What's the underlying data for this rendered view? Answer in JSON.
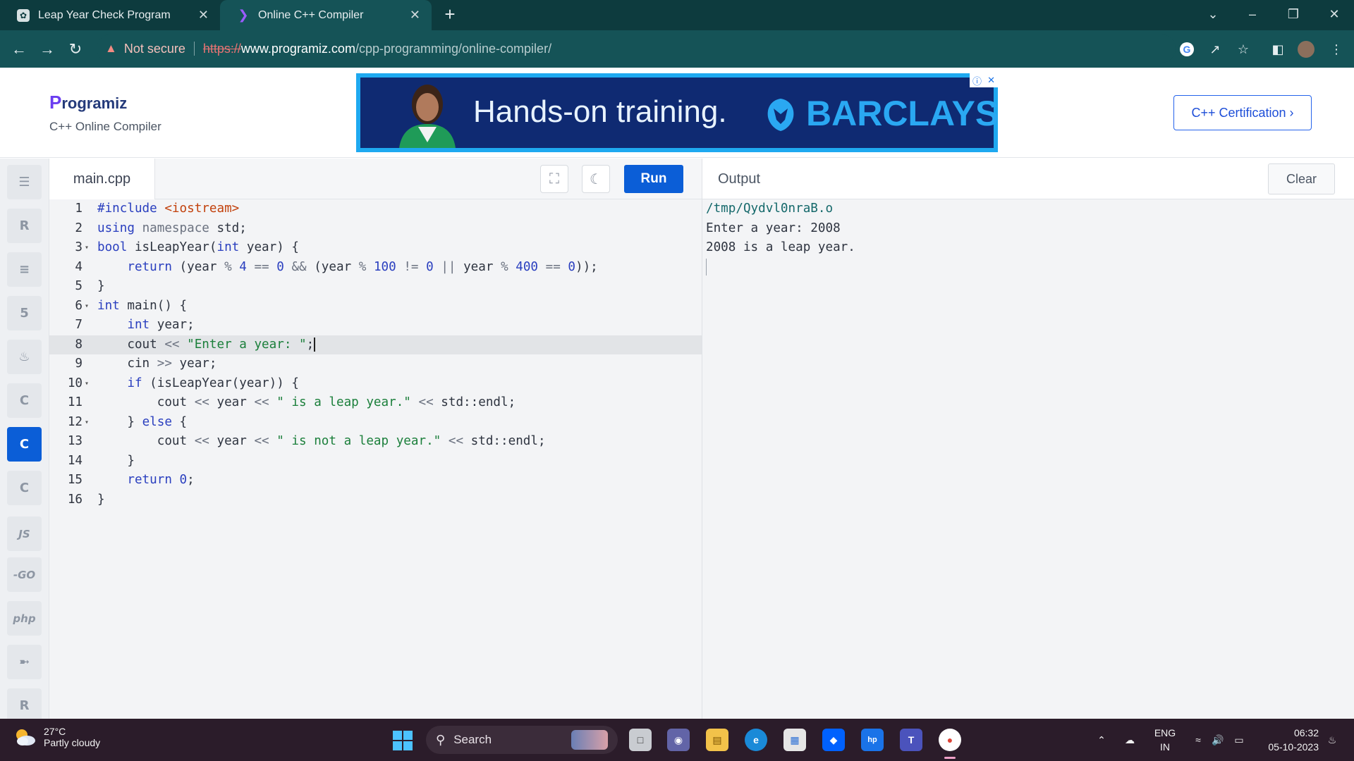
{
  "browser": {
    "tabs": [
      {
        "title": "Leap Year Check Program"
      },
      {
        "title": "Online C++ Compiler"
      }
    ],
    "address": {
      "security_label": "Not secure",
      "scheme": "https://",
      "domain": "www.programiz.com",
      "path": "/cpp-programming/online-compiler/"
    }
  },
  "header": {
    "logo_p": "P",
    "logo_rest": "rogramiz",
    "subtitle": "C++ Online Compiler",
    "ad_text": "Hands-on training.",
    "ad_brand": "BARCLAYS",
    "cert_button": "C++ Certification ›"
  },
  "sidebar": {
    "items": [
      {
        "name": "python",
        "glyph": "☰"
      },
      {
        "name": "r",
        "glyph": "R"
      },
      {
        "name": "sql",
        "glyph": "≡"
      },
      {
        "name": "html",
        "glyph": "5"
      },
      {
        "name": "java",
        "glyph": "♨"
      },
      {
        "name": "c",
        "glyph": "C"
      },
      {
        "name": "cpp",
        "glyph": "C"
      },
      {
        "name": "csharp",
        "glyph": "C"
      },
      {
        "name": "js",
        "glyph": "JS"
      },
      {
        "name": "go",
        "glyph": "-GO"
      },
      {
        "name": "php",
        "glyph": "php"
      },
      {
        "name": "swift",
        "glyph": "➼"
      },
      {
        "name": "rust",
        "glyph": "R"
      }
    ]
  },
  "editor": {
    "filename": "main.cpp",
    "run_label": "Run",
    "lines": [
      "1",
      "2",
      "3",
      "4",
      "5",
      "6",
      "7",
      "8",
      "9",
      "10",
      "11",
      "12",
      "13",
      "14",
      "15",
      "16"
    ]
  },
  "output": {
    "title": "Output",
    "clear_label": "Clear",
    "lines": [
      "/tmp/Qydvl0nraB.o",
      "Enter a year: 2008",
      "2008 is a leap year."
    ]
  },
  "taskbar": {
    "weather_temp": "27°C",
    "weather_desc": "Partly cloudy",
    "search_label": "Search",
    "lang_1": "ENG",
    "lang_2": "IN",
    "time": "06:32",
    "date": "05-10-2023"
  },
  "colors": {
    "chrome_dark": "#0d3b3e",
    "chrome_toolbar": "#155357",
    "accent": "#0b5ed7"
  }
}
